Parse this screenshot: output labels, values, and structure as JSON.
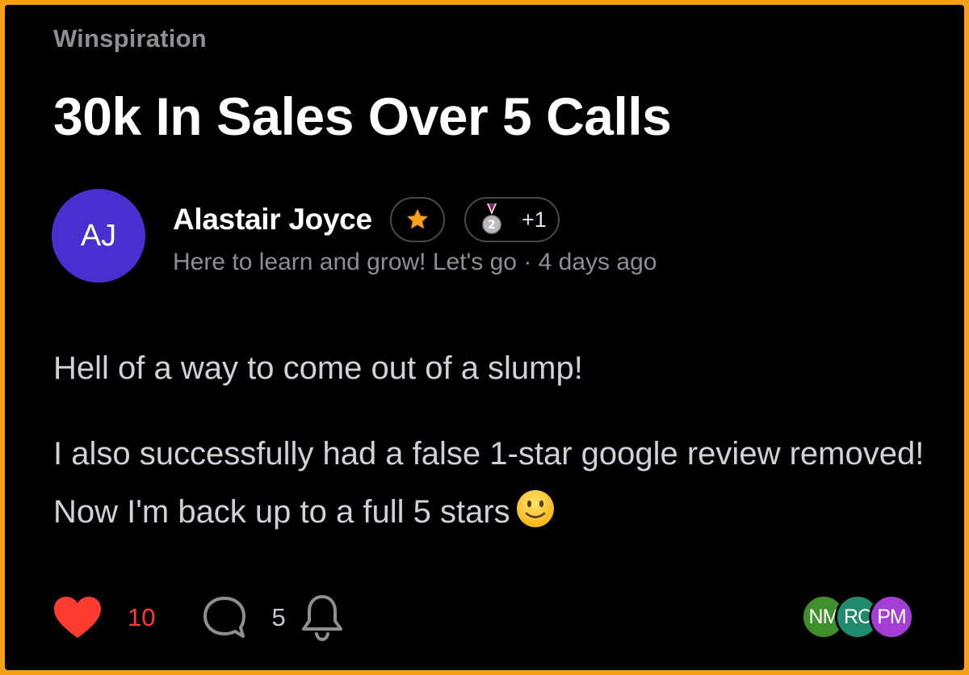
{
  "post": {
    "category": "Winspiration",
    "title": "30k In Sales Over 5 Calls",
    "author": {
      "initials": "AJ",
      "name": "Alastair Joyce",
      "bio": "Here to learn and grow! Let's go",
      "time": "4 days ago",
      "avatar_color": "#4a2fd0"
    },
    "badges": [
      {
        "icon": "star-icon"
      },
      {
        "icon": "silver-medal-icon",
        "medal_number": "2",
        "count": "+1"
      }
    ],
    "paragraphs": [
      "Hell of a way to come out of a slump!",
      "I also successfully had a false 1-star google review removed! Now I'm back up to a full 5 stars"
    ],
    "emoji": "slightly-smiling-face-icon"
  },
  "actions": {
    "likes": "10",
    "comments": "5",
    "like_color": "#ff3b30"
  },
  "participants": [
    {
      "initials": "NM",
      "color": "#3f8f2a"
    },
    {
      "initials": "RC",
      "color": "#1f8a6c"
    },
    {
      "initials": "PM",
      "color": "#a33fd6"
    }
  ],
  "colors": {
    "frame": "#f5a015",
    "background": "#000000"
  }
}
